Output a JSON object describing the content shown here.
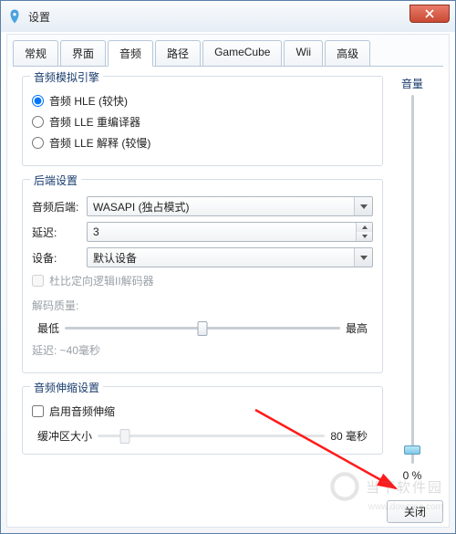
{
  "window": {
    "title": "设置"
  },
  "tabs": {
    "items": [
      {
        "label": "常规"
      },
      {
        "label": "界面"
      },
      {
        "label": "音频"
      },
      {
        "label": "路径"
      },
      {
        "label": "GameCube"
      },
      {
        "label": "Wii"
      },
      {
        "label": "高级"
      }
    ],
    "active": 2
  },
  "engine_group": {
    "legend": "音频模拟引擎",
    "options": [
      {
        "label": "音频 HLE (较快)",
        "checked": true
      },
      {
        "label": "音频 LLE 重编译器",
        "checked": false
      },
      {
        "label": "音频 LLE 解释 (较慢)",
        "checked": false
      }
    ]
  },
  "backend_group": {
    "legend": "后端设置",
    "backend_label": "音频后端:",
    "backend_value": "WASAPI (独占模式)",
    "latency_label": "延迟:",
    "latency_value": "3",
    "device_label": "设备:",
    "device_value": "默认设备",
    "dolby_label": "杜比定向逻辑II解码器",
    "decode_quality_label": "解码质量:",
    "slider_min": "最低",
    "slider_max": "最高",
    "latency_info": "延迟: ~40毫秒"
  },
  "stretch_group": {
    "legend": "音频伸缩设置",
    "enable_label": "启用音频伸缩",
    "buffer_label": "缓冲区大小",
    "buffer_value": "80 毫秒"
  },
  "volume": {
    "label": "音量",
    "value_text": "0 %"
  },
  "footer": {
    "close_label": "关闭"
  },
  "watermark": {
    "brand": "当下软件园",
    "url": "www.downxia.com"
  }
}
